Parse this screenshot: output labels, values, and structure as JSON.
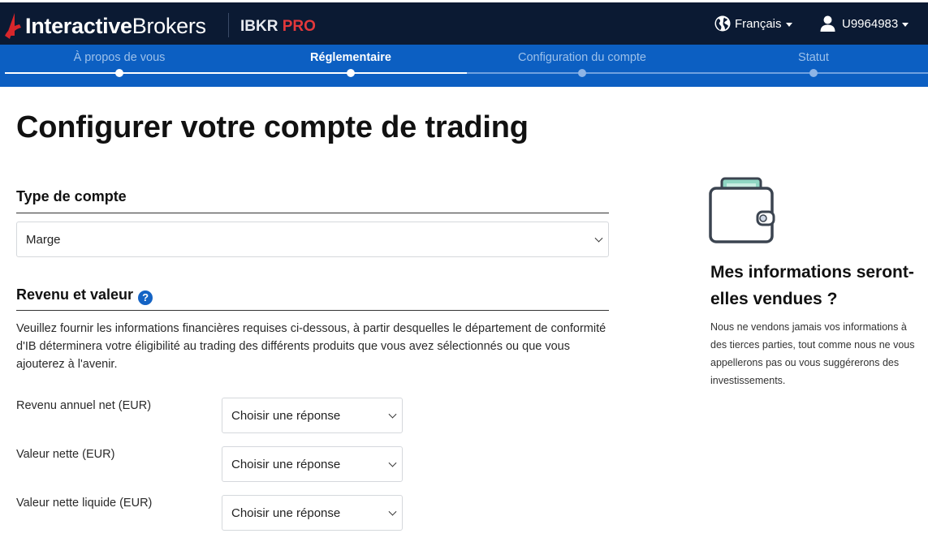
{
  "header": {
    "brand_bold": "Interactive",
    "brand_regular": "Brokers",
    "product_name": "IBKR",
    "product_tier": "PRO",
    "language_label": "Français",
    "language_icon": "globe-icon",
    "user_id": "U9964983",
    "user_icon": "user-icon"
  },
  "stepper": {
    "steps": [
      {
        "label": "À propos de vous",
        "state": "done"
      },
      {
        "label": "Réglementaire",
        "state": "active"
      },
      {
        "label": "Configuration du compte",
        "state": "todo"
      },
      {
        "label": "Statut",
        "state": "todo"
      }
    ]
  },
  "main": {
    "title": "Configurer votre compte de trading",
    "account_type": {
      "heading": "Type de compte",
      "selected": "Marge"
    },
    "income": {
      "heading": "Revenu et valeur",
      "help_symbol": "?",
      "description": "Veuillez fournir les informations financières requises ci-dessous, à partir desquelles le département de conformité d'IB déterminera votre éligibilité au trading des différents produits que vous avez sélectionnés ou que vous ajouterez à l'avenir.",
      "fields": [
        {
          "label": "Revenu annuel net (EUR)",
          "value": "Choisir une réponse"
        },
        {
          "label": "Valeur nette (EUR)",
          "value": "Choisir une réponse"
        },
        {
          "label": "Valeur nette liquide (EUR)",
          "value": "Choisir une réponse"
        }
      ]
    }
  },
  "sidebar_info": {
    "icon": "wallet-icon",
    "title": "Mes informations seront-elles vendues ?",
    "text": "Nous ne vendons jamais vos informations à des tierces parties, tout comme nous ne vous appellerons pas ou vous suggérerons des investissements."
  },
  "colors": {
    "header_bg": "#0b1a33",
    "stepper_bg": "#0c5fc2",
    "pro_red": "#e2383b",
    "help_blue": "#1463c4"
  }
}
